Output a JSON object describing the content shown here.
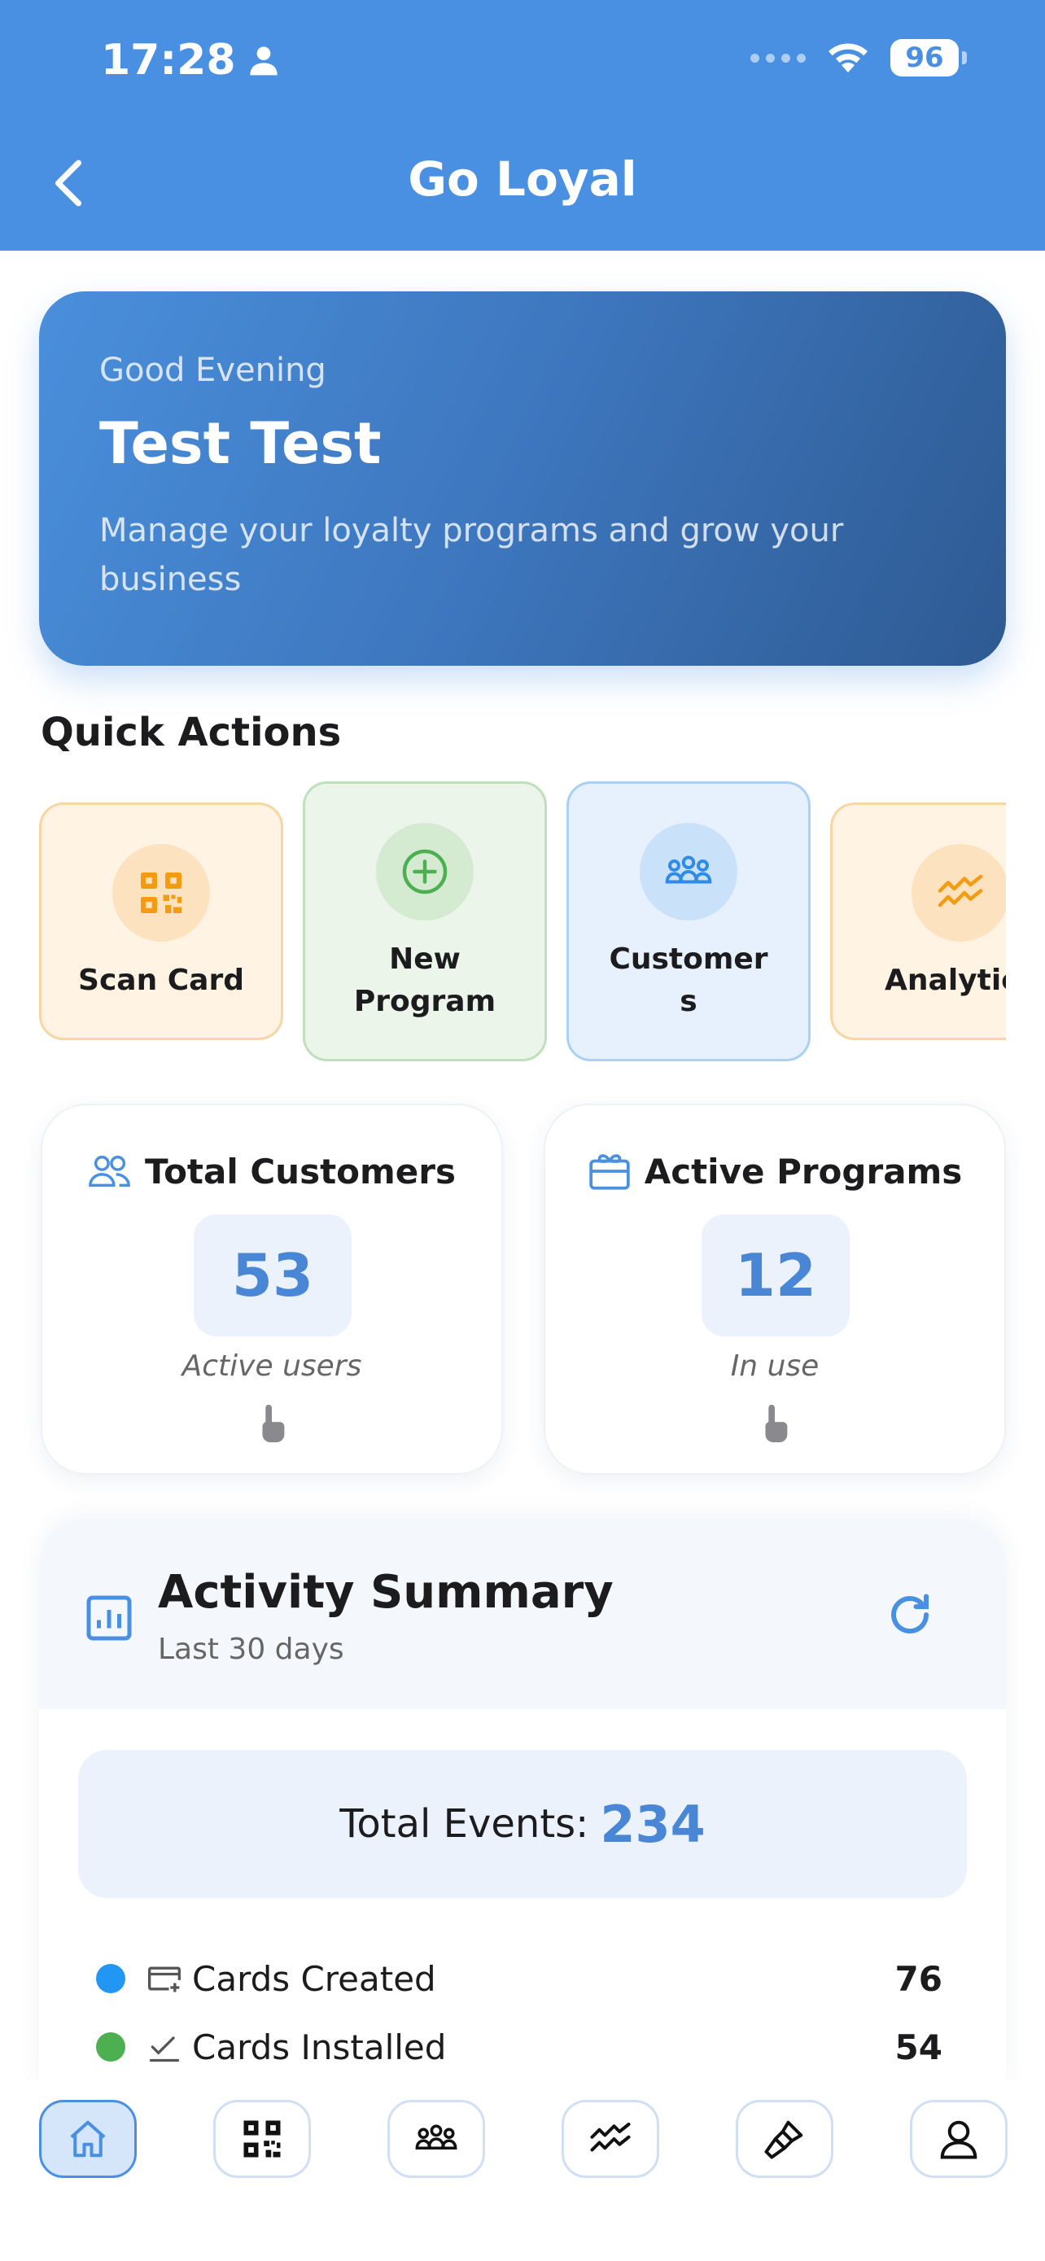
{
  "status_bar": {
    "time": "17:28",
    "battery": "96"
  },
  "nav": {
    "title": "Go Loyal"
  },
  "hero": {
    "greeting": "Good Evening",
    "name": "Test Test",
    "subtitle": "Manage your loyalty programs and grow your business"
  },
  "quick_actions": {
    "title": "Quick Actions",
    "items": [
      {
        "label": "Scan Card",
        "icon": "qr-code-icon",
        "color": "#f39c12"
      },
      {
        "label": "New Program",
        "icon": "plus-circle-icon",
        "color": "#4caf50"
      },
      {
        "label": "Customers",
        "icon": "group-icon",
        "color": "#2f8be6"
      },
      {
        "label": "Analytics",
        "icon": "trend-icon",
        "color": "#f39c12"
      }
    ]
  },
  "stats": {
    "total_customers": {
      "label": "Total Customers",
      "value": "53",
      "caption": "Active users"
    },
    "active_programs": {
      "label": "Active Programs",
      "value": "12",
      "caption": "In use"
    }
  },
  "activity": {
    "title": "Activity Summary",
    "subtitle": "Last 30 days",
    "total_label": "Total Events:",
    "total_value": "234",
    "rows": [
      {
        "label": "Cards Created",
        "count": "76",
        "color": "#2196f3"
      },
      {
        "label": "Cards Installed",
        "count": "54",
        "color": "#4caf50"
      }
    ]
  },
  "tabbar": {
    "items": [
      {
        "icon": "home-icon",
        "active": true
      },
      {
        "icon": "qr-code-icon",
        "active": false
      },
      {
        "icon": "group-icon",
        "active": false
      },
      {
        "icon": "trend-icon",
        "active": false
      },
      {
        "icon": "brush-icon",
        "active": false
      },
      {
        "icon": "profile-icon",
        "active": false
      }
    ]
  },
  "colors": {
    "primary": "#4a90e2",
    "accent_value": "#4a86d6"
  }
}
